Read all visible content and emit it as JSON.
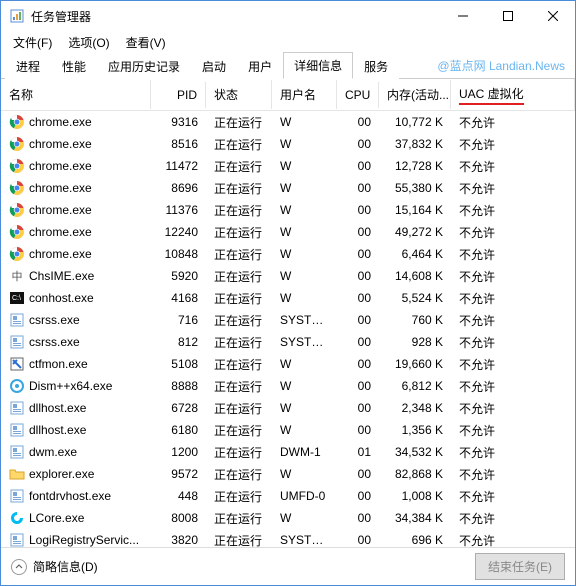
{
  "window": {
    "title": "任务管理器"
  },
  "menu": {
    "file": "文件(F)",
    "options": "选项(O)",
    "view": "查看(V)"
  },
  "tabs": {
    "processes": "进程",
    "performance": "性能",
    "history": "应用历史记录",
    "startup": "启动",
    "users": "用户",
    "details": "详细信息",
    "services": "服务"
  },
  "watermark": "@蓝点网 Landian.News",
  "columns": {
    "name": "名称",
    "pid": "PID",
    "status": "状态",
    "user": "用户名",
    "cpu": "CPU",
    "mem": "内存(活动...",
    "uac": "UAC 虚拟化"
  },
  "rows": [
    {
      "icon": "chrome",
      "name": "chrome.exe",
      "pid": "9316",
      "status": "正在运行",
      "user": "W",
      "cpu": "00",
      "mem": "10,772 K",
      "uac": "不允许"
    },
    {
      "icon": "chrome",
      "name": "chrome.exe",
      "pid": "8516",
      "status": "正在运行",
      "user": "W",
      "cpu": "00",
      "mem": "37,832 K",
      "uac": "不允许"
    },
    {
      "icon": "chrome",
      "name": "chrome.exe",
      "pid": "11472",
      "status": "正在运行",
      "user": "W",
      "cpu": "00",
      "mem": "12,728 K",
      "uac": "不允许"
    },
    {
      "icon": "chrome",
      "name": "chrome.exe",
      "pid": "8696",
      "status": "正在运行",
      "user": "W",
      "cpu": "00",
      "mem": "55,380 K",
      "uac": "不允许"
    },
    {
      "icon": "chrome",
      "name": "chrome.exe",
      "pid": "11376",
      "status": "正在运行",
      "user": "W",
      "cpu": "00",
      "mem": "15,164 K",
      "uac": "不允许"
    },
    {
      "icon": "chrome",
      "name": "chrome.exe",
      "pid": "12240",
      "status": "正在运行",
      "user": "W",
      "cpu": "00",
      "mem": "49,272 K",
      "uac": "不允许"
    },
    {
      "icon": "chrome",
      "name": "chrome.exe",
      "pid": "10848",
      "status": "正在运行",
      "user": "W",
      "cpu": "00",
      "mem": "6,464 K",
      "uac": "不允许"
    },
    {
      "icon": "ime",
      "name": "ChsIME.exe",
      "pid": "5920",
      "status": "正在运行",
      "user": "W",
      "cpu": "00",
      "mem": "14,608 K",
      "uac": "不允许"
    },
    {
      "icon": "conhost",
      "name": "conhost.exe",
      "pid": "4168",
      "status": "正在运行",
      "user": "W",
      "cpu": "00",
      "mem": "5,524 K",
      "uac": "不允许"
    },
    {
      "icon": "generic",
      "name": "csrss.exe",
      "pid": "716",
      "status": "正在运行",
      "user": "SYSTEM",
      "cpu": "00",
      "mem": "760 K",
      "uac": "不允许"
    },
    {
      "icon": "generic",
      "name": "csrss.exe",
      "pid": "812",
      "status": "正在运行",
      "user": "SYSTEM",
      "cpu": "00",
      "mem": "928 K",
      "uac": "不允许"
    },
    {
      "icon": "ctfmon",
      "name": "ctfmon.exe",
      "pid": "5108",
      "status": "正在运行",
      "user": "W",
      "cpu": "00",
      "mem": "19,660 K",
      "uac": "不允许"
    },
    {
      "icon": "dism",
      "name": "Dism++x64.exe",
      "pid": "8888",
      "status": "正在运行",
      "user": "W",
      "cpu": "00",
      "mem": "6,812 K",
      "uac": "不允许"
    },
    {
      "icon": "generic",
      "name": "dllhost.exe",
      "pid": "6728",
      "status": "正在运行",
      "user": "W",
      "cpu": "00",
      "mem": "2,348 K",
      "uac": "不允许"
    },
    {
      "icon": "generic",
      "name": "dllhost.exe",
      "pid": "6180",
      "status": "正在运行",
      "user": "W",
      "cpu": "00",
      "mem": "1,356 K",
      "uac": "不允许"
    },
    {
      "icon": "generic",
      "name": "dwm.exe",
      "pid": "1200",
      "status": "正在运行",
      "user": "DWM-1",
      "cpu": "01",
      "mem": "34,532 K",
      "uac": "不允许"
    },
    {
      "icon": "explorer",
      "name": "explorer.exe",
      "pid": "9572",
      "status": "正在运行",
      "user": "W",
      "cpu": "00",
      "mem": "82,868 K",
      "uac": "不允许"
    },
    {
      "icon": "generic",
      "name": "fontdrvhost.exe",
      "pid": "448",
      "status": "正在运行",
      "user": "UMFD-0",
      "cpu": "00",
      "mem": "1,008 K",
      "uac": "不允许"
    },
    {
      "icon": "lcore",
      "name": "LCore.exe",
      "pid": "8008",
      "status": "正在运行",
      "user": "W",
      "cpu": "00",
      "mem": "34,384 K",
      "uac": "不允许"
    },
    {
      "icon": "generic",
      "name": "LogiRegistryServic...",
      "pid": "3820",
      "status": "正在运行",
      "user": "SYSTEM",
      "cpu": "00",
      "mem": "696 K",
      "uac": "不允许"
    }
  ],
  "footer": {
    "less": "简略信息(D)",
    "end": "结束任务(E)"
  }
}
